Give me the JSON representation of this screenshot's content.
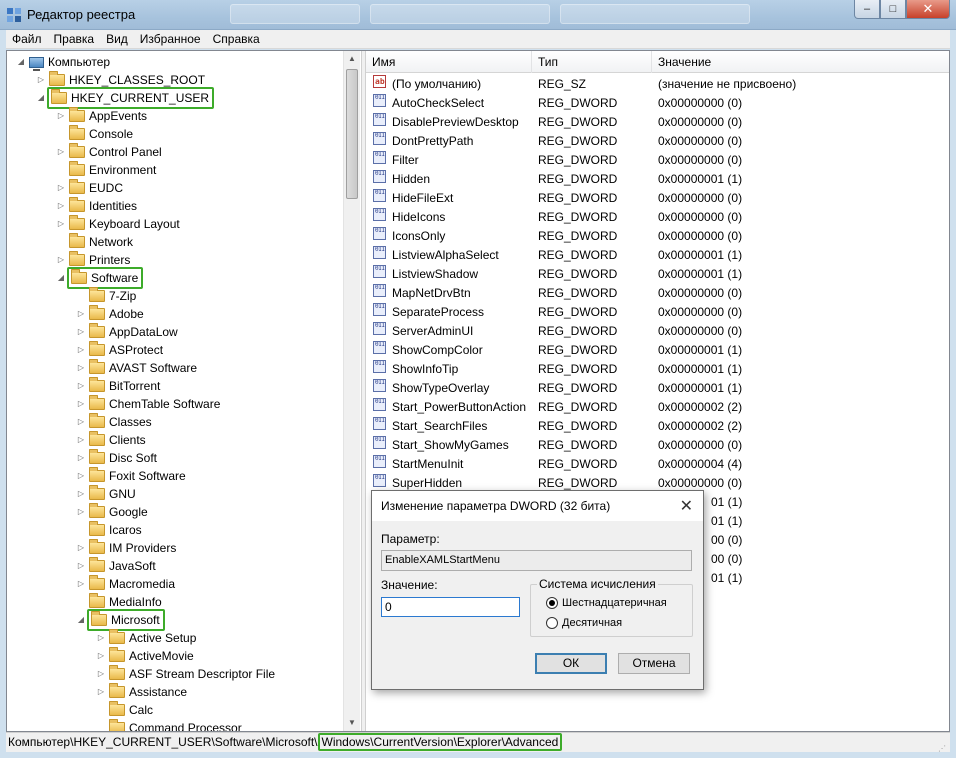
{
  "window": {
    "title": "Редактор реестра",
    "controls": {
      "minimize": "‒",
      "maximize": "□",
      "close": "✕"
    }
  },
  "menu": [
    "Файл",
    "Правка",
    "Вид",
    "Избранное",
    "Справка"
  ],
  "tree": {
    "root": "Компьютер",
    "items": [
      {
        "label": "HKEY_CLASSES_ROOT",
        "level": 1,
        "toggle": "closed"
      },
      {
        "label": "HKEY_CURRENT_USER",
        "level": 1,
        "toggle": "open",
        "highlight": true
      },
      {
        "label": "AppEvents",
        "level": 2,
        "toggle": "closed"
      },
      {
        "label": "Console",
        "level": 2,
        "toggle": "none"
      },
      {
        "label": "Control Panel",
        "level": 2,
        "toggle": "closed"
      },
      {
        "label": "Environment",
        "level": 2,
        "toggle": "none"
      },
      {
        "label": "EUDC",
        "level": 2,
        "toggle": "closed"
      },
      {
        "label": "Identities",
        "level": 2,
        "toggle": "closed"
      },
      {
        "label": "Keyboard Layout",
        "level": 2,
        "toggle": "closed"
      },
      {
        "label": "Network",
        "level": 2,
        "toggle": "none"
      },
      {
        "label": "Printers",
        "level": 2,
        "toggle": "closed"
      },
      {
        "label": "Software",
        "level": 2,
        "toggle": "open",
        "highlight": true
      },
      {
        "label": "7-Zip",
        "level": 3,
        "toggle": "none"
      },
      {
        "label": "Adobe",
        "level": 3,
        "toggle": "closed"
      },
      {
        "label": "AppDataLow",
        "level": 3,
        "toggle": "closed"
      },
      {
        "label": "ASProtect",
        "level": 3,
        "toggle": "closed"
      },
      {
        "label": "AVAST Software",
        "level": 3,
        "toggle": "closed"
      },
      {
        "label": "BitTorrent",
        "level": 3,
        "toggle": "closed"
      },
      {
        "label": "ChemTable Software",
        "level": 3,
        "toggle": "closed"
      },
      {
        "label": "Classes",
        "level": 3,
        "toggle": "closed"
      },
      {
        "label": "Clients",
        "level": 3,
        "toggle": "closed"
      },
      {
        "label": "Disc Soft",
        "level": 3,
        "toggle": "closed"
      },
      {
        "label": "Foxit Software",
        "level": 3,
        "toggle": "closed"
      },
      {
        "label": "GNU",
        "level": 3,
        "toggle": "closed"
      },
      {
        "label": "Google",
        "level": 3,
        "toggle": "closed"
      },
      {
        "label": "Icaros",
        "level": 3,
        "toggle": "none"
      },
      {
        "label": "IM Providers",
        "level": 3,
        "toggle": "closed"
      },
      {
        "label": "JavaSoft",
        "level": 3,
        "toggle": "closed"
      },
      {
        "label": "Macromedia",
        "level": 3,
        "toggle": "closed"
      },
      {
        "label": "MediaInfo",
        "level": 3,
        "toggle": "none"
      },
      {
        "label": "Microsoft",
        "level": 3,
        "toggle": "open",
        "highlight": true
      },
      {
        "label": "Active Setup",
        "level": 4,
        "toggle": "closed"
      },
      {
        "label": "ActiveMovie",
        "level": 4,
        "toggle": "closed"
      },
      {
        "label": "ASF Stream Descriptor File",
        "level": 4,
        "toggle": "closed"
      },
      {
        "label": "Assistance",
        "level": 4,
        "toggle": "closed"
      },
      {
        "label": "Calc",
        "level": 4,
        "toggle": "none"
      },
      {
        "label": "Command Processor",
        "level": 4,
        "toggle": "none"
      }
    ]
  },
  "list": {
    "columns": [
      "Имя",
      "Тип",
      "Значение"
    ],
    "rows": [
      {
        "name": "(По умолчанию)",
        "type": "REG_SZ",
        "value": "(значение не присвоено)",
        "icon": "string"
      },
      {
        "name": "AutoCheckSelect",
        "type": "REG_DWORD",
        "value": "0x00000000 (0)",
        "icon": "binary"
      },
      {
        "name": "DisablePreviewDesktop",
        "type": "REG_DWORD",
        "value": "0x00000000 (0)",
        "icon": "binary"
      },
      {
        "name": "DontPrettyPath",
        "type": "REG_DWORD",
        "value": "0x00000000 (0)",
        "icon": "binary"
      },
      {
        "name": "Filter",
        "type": "REG_DWORD",
        "value": "0x00000000 (0)",
        "icon": "binary"
      },
      {
        "name": "Hidden",
        "type": "REG_DWORD",
        "value": "0x00000001 (1)",
        "icon": "binary"
      },
      {
        "name": "HideFileExt",
        "type": "REG_DWORD",
        "value": "0x00000000 (0)",
        "icon": "binary"
      },
      {
        "name": "HideIcons",
        "type": "REG_DWORD",
        "value": "0x00000000 (0)",
        "icon": "binary"
      },
      {
        "name": "IconsOnly",
        "type": "REG_DWORD",
        "value": "0x00000000 (0)",
        "icon": "binary"
      },
      {
        "name": "ListviewAlphaSelect",
        "type": "REG_DWORD",
        "value": "0x00000001 (1)",
        "icon": "binary"
      },
      {
        "name": "ListviewShadow",
        "type": "REG_DWORD",
        "value": "0x00000001 (1)",
        "icon": "binary"
      },
      {
        "name": "MapNetDrvBtn",
        "type": "REG_DWORD",
        "value": "0x00000000 (0)",
        "icon": "binary"
      },
      {
        "name": "SeparateProcess",
        "type": "REG_DWORD",
        "value": "0x00000000 (0)",
        "icon": "binary"
      },
      {
        "name": "ServerAdminUI",
        "type": "REG_DWORD",
        "value": "0x00000000 (0)",
        "icon": "binary"
      },
      {
        "name": "ShowCompColor",
        "type": "REG_DWORD",
        "value": "0x00000001 (1)",
        "icon": "binary"
      },
      {
        "name": "ShowInfoTip",
        "type": "REG_DWORD",
        "value": "0x00000001 (1)",
        "icon": "binary"
      },
      {
        "name": "ShowTypeOverlay",
        "type": "REG_DWORD",
        "value": "0x00000001 (1)",
        "icon": "binary"
      },
      {
        "name": "Start_PowerButtonAction",
        "type": "REG_DWORD",
        "value": "0x00000002 (2)",
        "icon": "binary"
      },
      {
        "name": "Start_SearchFiles",
        "type": "REG_DWORD",
        "value": "0x00000002 (2)",
        "icon": "binary"
      },
      {
        "name": "Start_ShowMyGames",
        "type": "REG_DWORD",
        "value": "0x00000000 (0)",
        "icon": "binary"
      },
      {
        "name": "StartMenuInit",
        "type": "REG_DWORD",
        "value": "0x00000004 (4)",
        "icon": "binary"
      },
      {
        "name": "SuperHidden",
        "type": "REG_DWORD",
        "value": "0x00000000 (0)",
        "icon": "binary"
      }
    ],
    "partial_values": [
      "01 (1)",
      "01 (1)",
      "00 (0)",
      "00 (0)",
      "01 (1)"
    ]
  },
  "dialog": {
    "title": "Изменение параметра DWORD (32 бита)",
    "close": "✕",
    "param_label": "Параметр:",
    "param_value": "EnableXAMLStartMenu",
    "value_label": "Значение:",
    "value": "0",
    "base_label": "Система исчисления",
    "hex_label": "Шестнадцатеричная",
    "dec_label": "Десятичная",
    "selected_base": "hex",
    "ok": "ОК",
    "cancel": "Отмена"
  },
  "status": {
    "path_prefix": "Компьютер\\HKEY_CURRENT_USER\\Software\\Microsoft\\",
    "path_highlight": "Windows\\CurrentVersion\\Explorer\\Advanced"
  },
  "colors": {
    "highlight_box": "#3dab2a",
    "accent": "#2b79d0"
  }
}
